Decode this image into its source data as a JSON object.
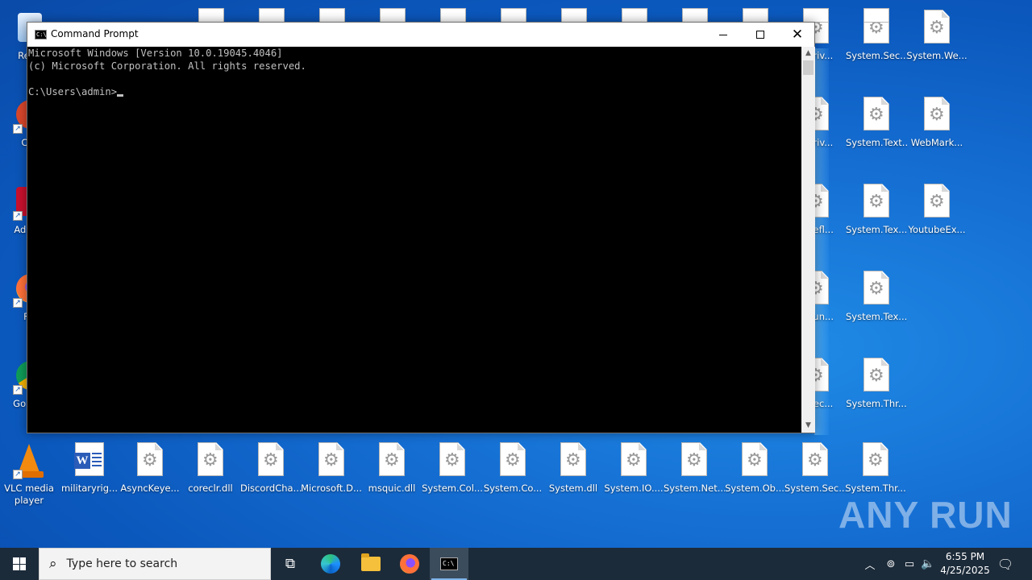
{
  "desktop": {
    "left_icons": [
      {
        "label": "Recy",
        "kind": "recycle"
      },
      {
        "label": "CCl",
        "kind": "ccleaner"
      },
      {
        "label": "Ad Acr",
        "kind": "acrobat"
      },
      {
        "label": "Fir",
        "kind": "firefox"
      },
      {
        "label": "Go Chr",
        "kind": "chrome"
      }
    ],
    "right_col_a": [
      {
        "label": "n.Priv..."
      },
      {
        "label": "n.Priv..."
      },
      {
        "label": "n.Refl..."
      },
      {
        "label": "n.Run..."
      },
      {
        "label": "n.Sec..."
      }
    ],
    "right_col_b": [
      {
        "label": "System.Sec..."
      },
      {
        "label": "System.Text..."
      },
      {
        "label": "System.Tex..."
      },
      {
        "label": "System.Tex..."
      },
      {
        "label": "System.Thr..."
      }
    ],
    "right_col_c": [
      {
        "label": "System.We..."
      },
      {
        "label": "WebMark..."
      },
      {
        "label": "YoutubeEx..."
      }
    ],
    "bottom_row": [
      {
        "label": "VLC media player",
        "kind": "vlc"
      },
      {
        "label": "militaryrig...",
        "kind": "word"
      },
      {
        "label": "AsyncKeye...",
        "kind": "dll"
      },
      {
        "label": "coreclr.dll",
        "kind": "dll"
      },
      {
        "label": "DiscordCha...",
        "kind": "dll"
      },
      {
        "label": "Microsoft.D...",
        "kind": "dll"
      },
      {
        "label": "msquic.dll",
        "kind": "dll"
      },
      {
        "label": "System.Col...",
        "kind": "dll"
      },
      {
        "label": "System.Co...",
        "kind": "dll"
      },
      {
        "label": "System.dll",
        "kind": "dll"
      },
      {
        "label": "System.IO....",
        "kind": "dll"
      },
      {
        "label": "System.Net...",
        "kind": "dll"
      },
      {
        "label": "System.Ob...",
        "kind": "dll"
      },
      {
        "label": "System.Sec...",
        "kind": "dll"
      },
      {
        "label": "System.Thr...",
        "kind": "dll"
      }
    ]
  },
  "cmd_window": {
    "title": "Command Prompt",
    "title_icon": "C:\\",
    "lines": [
      "Microsoft Windows [Version 10.0.19045.4046]",
      "(c) Microsoft Corporation. All rights reserved.",
      "",
      "C:\\Users\\admin>"
    ],
    "buttons": {
      "minimize": "minimize-icon",
      "maximize": "maximize-icon",
      "close": "close-icon"
    }
  },
  "watermark": "ANY RUN",
  "taskbar": {
    "search_placeholder": "Type here to search",
    "cmd_icon_text": "C:\\",
    "clock_time": "6:55 PM",
    "clock_date": "4/25/2025"
  }
}
